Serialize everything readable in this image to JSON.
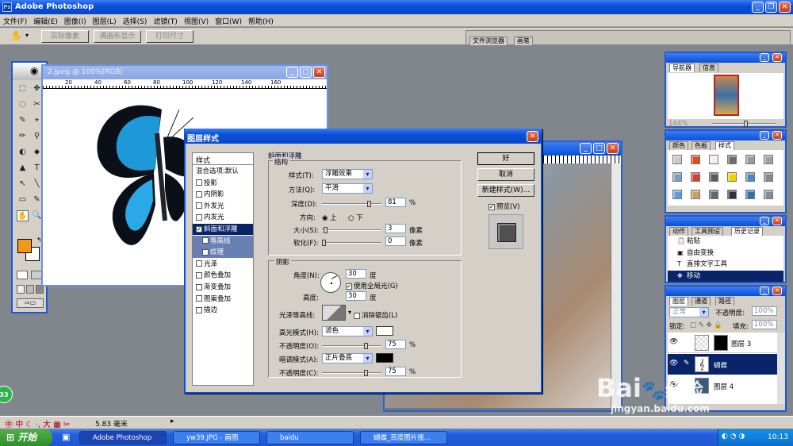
{
  "app": {
    "title": "Adobe Photoshop"
  },
  "menu": [
    "文件(F)",
    "编辑(E)",
    "图像(I)",
    "图层(L)",
    "选择(S)",
    "滤镜(T)",
    "视图(V)",
    "窗口(W)",
    "帮助(H)"
  ],
  "options": {
    "btn1": "实际像素",
    "btn2": "满画布显示",
    "btn3": "打印尺寸",
    "tab1": "文件浏览器",
    "tab2": "画笔"
  },
  "doc": {
    "title": "2.jpeg @ 100%(RGB)",
    "ruler": [
      "20",
      "40",
      "60",
      "80",
      "100",
      "120",
      "140",
      "160"
    ]
  },
  "dialog": {
    "title": "图层样式",
    "list_header": "样式",
    "list": [
      {
        "label": "混合选项:默认",
        "check": null,
        "sel": false,
        "sub": false
      },
      {
        "label": "投影",
        "check": false,
        "sel": false,
        "sub": false
      },
      {
        "label": "内阴影",
        "check": false,
        "sel": false,
        "sub": false
      },
      {
        "label": "外发光",
        "check": false,
        "sel": false,
        "sub": false
      },
      {
        "label": "内发光",
        "check": false,
        "sel": false,
        "sub": false
      },
      {
        "label": "斜面和浮雕",
        "check": true,
        "sel": true,
        "sub": false
      },
      {
        "label": "等高线",
        "check": false,
        "sel": true,
        "sub": true
      },
      {
        "label": "纹理",
        "check": false,
        "sel": true,
        "sub": true
      },
      {
        "label": "光泽",
        "check": false,
        "sel": false,
        "sub": false
      },
      {
        "label": "颜色叠加",
        "check": false,
        "sel": false,
        "sub": false
      },
      {
        "label": "渐变叠加",
        "check": false,
        "sel": false,
        "sub": false
      },
      {
        "label": "图案叠加",
        "check": false,
        "sel": false,
        "sub": false
      },
      {
        "label": "描边",
        "check": false,
        "sel": false,
        "sub": false
      }
    ],
    "section": "斜面和浮雕",
    "structure": "结构",
    "style_label": "样式(T):",
    "style_val": "浮雕效果",
    "method_label": "方法(Q):",
    "method_val": "平滑",
    "depth_label": "深度(D):",
    "depth_val": "81",
    "depth_pct": 81,
    "pct": "%",
    "dir_label": "方向:",
    "dir_up": "上",
    "dir_down": "下",
    "size_label": "大小(S):",
    "size_val": "3",
    "size_pct": 3,
    "px": "像素",
    "soft_label": "软化(F):",
    "soft_val": "0",
    "soft_pct": 0,
    "shading": "阴影",
    "angle_label": "角度(N):",
    "angle_val": "30",
    "deg": "度",
    "global_light": "使用全局光(G)",
    "alt_label": "高度:",
    "alt_val": "30",
    "gloss_label": "光泽等高线:",
    "anti_alias": "消除锯齿(L)",
    "hl_label": "高光模式(H):",
    "hl_val": "滤色",
    "hl_color": "#ffffff",
    "op_label": "不透明度(O):",
    "op1_val": "75",
    "op1_pct": 75,
    "sh_label": "暗调模式(A):",
    "sh_val": "正片叠底",
    "sh_color": "#000000",
    "op2_label": "不透明度(C):",
    "op2_val": "75",
    "op2_pct": 75,
    "ok": "好",
    "cancel": "取消",
    "new_style": "新建样式(W)...",
    "preview": "预览(V)"
  },
  "navigator": {
    "tab1": "导航器",
    "tab2": "信息",
    "zoom": "144%"
  },
  "styles": {
    "tab1": "颜色",
    "tab2": "色板",
    "tab3": "样式",
    "swatches": [
      "#c8c8c8",
      "#e14a1a",
      "#f0f0f0",
      "#6c6c6c",
      "#9a9a9a",
      "#a0a0a0",
      "#7aa0c8",
      "#d63c3c",
      "#5c5c5c",
      "#f0d000",
      "#4a88c8",
      "#888888",
      "#5aa0e0",
      "#c8a060",
      "#606870",
      "#303040",
      "#3070b0",
      "#8090a0"
    ]
  },
  "history": {
    "tab1": "动作",
    "tab2": "工具预设",
    "tab3": "历史记录",
    "items": [
      "粘贴",
      "自由变换",
      "直排文字工具",
      "移动"
    ],
    "icons": [
      "📋",
      "▣",
      "T",
      "✥"
    ]
  },
  "layers": {
    "tab1": "图层",
    "tab2": "通道",
    "tab3": "路径",
    "mode": "正常",
    "opacity_label": "不透明度:",
    "opacity": "100%",
    "lock_label": "锁定:",
    "fill_label": "填充:",
    "fill": "100%",
    "rows": [
      "图层 3",
      "蝴蝶",
      "图层 4"
    ]
  },
  "status": {
    "ime": "中",
    "text": "5.83 毫米",
    "badge": "33"
  },
  "taskbar": {
    "start": "开始",
    "items": [
      "Adobe Photoshop",
      "yw39.JPG - 画图",
      "baidu",
      "蝴蝶_百度图片搜..."
    ],
    "time": "10:13"
  },
  "watermark": {
    "brand": "Bai",
    "brand2": "经验",
    "url": "jingyan.baidu.com"
  },
  "colors": {
    "fg": "#f29a17",
    "bg": "#ffffff"
  }
}
